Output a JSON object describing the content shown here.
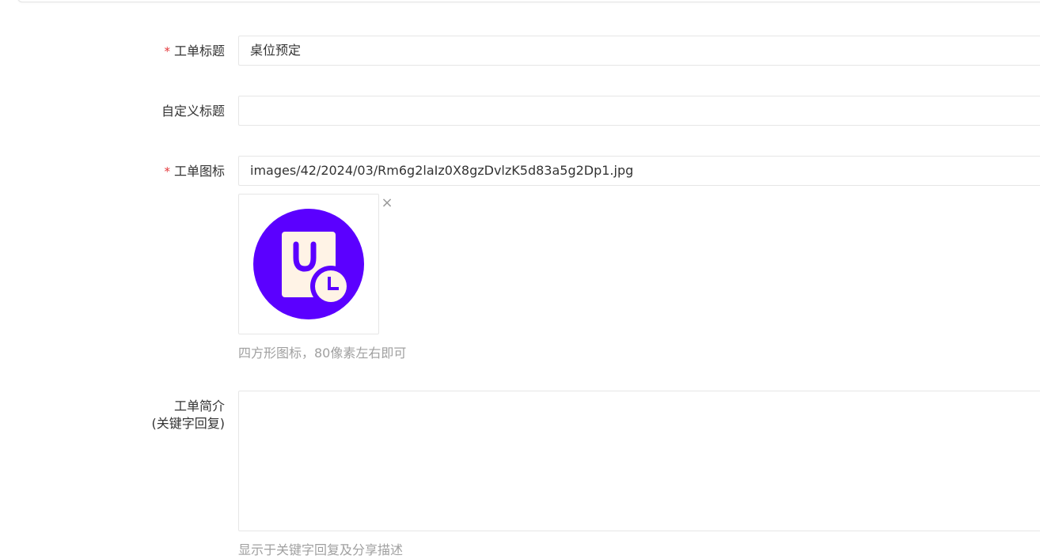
{
  "form": {
    "title_field": {
      "required_mark": "*",
      "label": "工单标题",
      "value": "桌位预定"
    },
    "custom_title_field": {
      "label": "自定义标题",
      "value": ""
    },
    "icon_field": {
      "required_mark": "*",
      "label": "工单图标",
      "value": "images/42/2024/03/Rm6g2laIz0X8gzDvlzK5d83a5g2Dp1.jpg",
      "remove_glyph": "×",
      "preview_icon": "shopping-bag-clock-icon",
      "hint": "四方形图标，80像素左右即可"
    },
    "intro_field": {
      "label_line1": "工单简介",
      "label_line2": "(关键字回复)",
      "value": "",
      "hint": "显示于关键字回复及分享描述"
    }
  },
  "colors": {
    "required": "#e4393c",
    "icon_bg": "#5b00ff",
    "icon_fg": "#fff3e6",
    "hint": "#a0a0a0",
    "border": "#e6e6e6"
  }
}
